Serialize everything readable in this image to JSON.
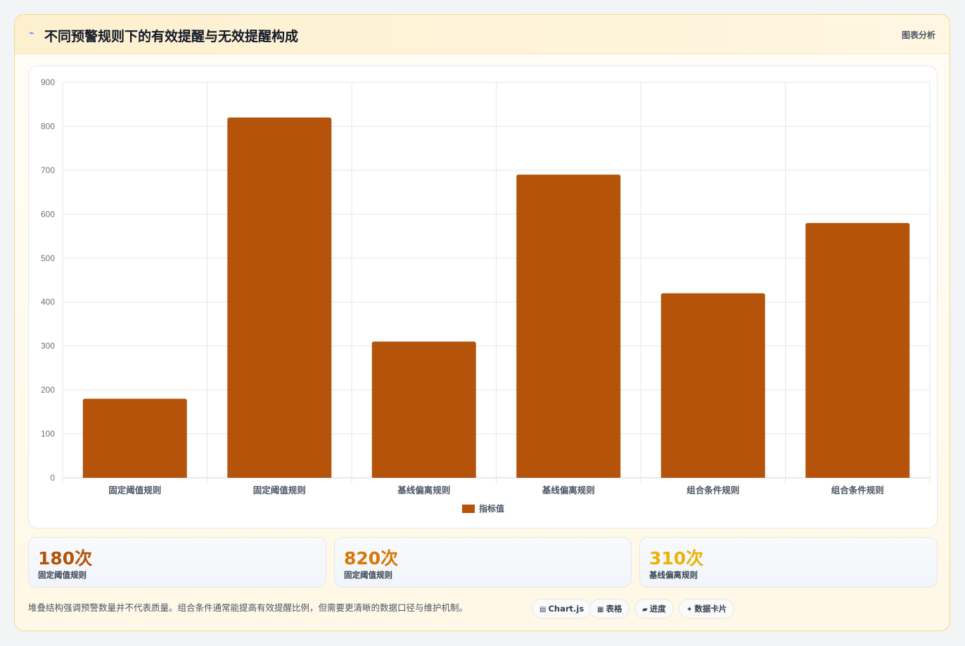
{
  "header": {
    "icon": "chart-line-icon",
    "title": "不同预警规则下的有效提醒与无效提醒构成",
    "tag": "图表分析"
  },
  "chart_data": {
    "type": "bar",
    "categories": [
      "固定阈值规则",
      "固定阈值规则",
      "基线偏离规则",
      "基线偏离规则",
      "组合条件规则",
      "组合条件规则"
    ],
    "series": [
      {
        "name": "指标值",
        "values": [
          180,
          820,
          310,
          690,
          420,
          580
        ],
        "color": "#b45309"
      }
    ],
    "ylim": [
      0,
      900
    ],
    "yticks": [
      0,
      100,
      200,
      300,
      400,
      500,
      600,
      700,
      800,
      900
    ],
    "grid": true,
    "legend": "bottom-center"
  },
  "stats": [
    {
      "value": "180次",
      "label": "固定阈值规则",
      "color": "#b45309"
    },
    {
      "value": "820次",
      "label": "固定阈值规则",
      "color": "#d97706"
    },
    {
      "value": "310次",
      "label": "基线偏离规则",
      "color": "#eab308"
    }
  ],
  "footnote": "堆叠结构强调预警数量并不代表质量。组合条件通常能提高有效提醒比例，但需要更清晰的数据口径与维护机制。",
  "pills": [
    {
      "icon": "chart-icon",
      "glyph": "▤",
      "label": "Chart.js"
    },
    {
      "icon": "table-icon",
      "glyph": "▦",
      "label": "表格"
    },
    {
      "icon": "progress-icon",
      "glyph": "▰",
      "label": "进度"
    },
    {
      "icon": "sparkle-icon",
      "glyph": "✦",
      "label": "数据卡片"
    }
  ]
}
